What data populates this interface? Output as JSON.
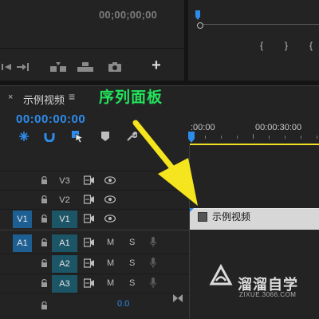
{
  "top_panel": {
    "timecode": "00;00;00;00",
    "add_button_label": "+"
  },
  "timeline": {
    "tab_close": "×",
    "tab_title": "示例视频",
    "tab_menu": "≡",
    "annotation_label": "序列面板",
    "timecode": "00:00:00:00",
    "ruler": {
      "start_label": ":00:00",
      "mid_label": "00:00:30:00"
    },
    "video_tracks": [
      {
        "source": "",
        "name": "V3"
      },
      {
        "source": "",
        "name": "V2"
      },
      {
        "source": "V1",
        "name": "V1"
      }
    ],
    "audio_tracks": [
      {
        "source": "A1",
        "name": "A1",
        "m": "M",
        "s": "S"
      },
      {
        "source": "",
        "name": "A2",
        "m": "M",
        "s": "S"
      },
      {
        "source": "",
        "name": "A3",
        "m": "M",
        "s": "S"
      }
    ],
    "master_volume": "0.0",
    "clip_label": "示例视频"
  },
  "watermark": {
    "cn": "溜溜自学",
    "url": "ZIXUE.3066.COM"
  },
  "colors": {
    "timecode_blue": "#2d8ceb",
    "annotation_green": "#22e25a",
    "arrow_yellow": "#f5e51e",
    "track_target_blue": "#1d5f93",
    "track_name_teal": "#1b5566"
  },
  "icons": [
    "snap-icon",
    "linked-selection-icon",
    "add-marker-icon",
    "marker-icon",
    "wrench-icon",
    "lock-icon",
    "toggle-sync-icon",
    "eye-icon",
    "mic-icon",
    "camera-icon"
  ]
}
